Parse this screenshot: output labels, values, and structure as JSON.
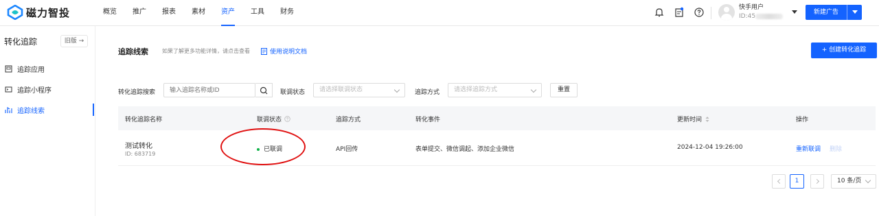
{
  "brand": {
    "name": "磁力智投",
    "accent": "#1463ff"
  },
  "nav": {
    "items": [
      "概览",
      "推广",
      "报表",
      "素材",
      "资产",
      "工具",
      "财务"
    ],
    "active_index": 4
  },
  "topbar": {
    "icons": [
      "bell-icon",
      "message-icon",
      "help-icon"
    ],
    "user": {
      "name": "快手用户",
      "id_prefix": "ID:45"
    },
    "new_ad_label": "新建广告"
  },
  "sidebar": {
    "title": "转化追踪",
    "old_version_label": "旧版 →",
    "items": [
      {
        "label": "追踪应用",
        "icon": "app-icon",
        "active": false
      },
      {
        "label": "追踪小程序",
        "icon": "mini-program-icon",
        "active": false
      },
      {
        "label": "追踪线索",
        "icon": "leads-icon",
        "active": true
      }
    ]
  },
  "header": {
    "title": "追踪线索",
    "tip": "如果了解更多功能详情，请点击查看",
    "doc_link": "使用说明文档",
    "create_button": "+ 创建转化追踪"
  },
  "filters": {
    "search_label": "转化追踪搜索",
    "search_placeholder": "输入追踪名称或ID",
    "status_label": "联调状态",
    "status_placeholder": "请选择联调状态",
    "method_label": "追踪方式",
    "method_placeholder": "请选择追踪方式",
    "reset_label": "重置"
  },
  "table": {
    "columns": [
      "转化追踪名称",
      "联调状态",
      "追踪方式",
      "转化事件",
      "更新时间",
      "操作"
    ],
    "rows": [
      {
        "name": "测试转化",
        "id": "ID: 683719",
        "status": "已联调",
        "method": "API回传",
        "events": "表单提交、微信调起、添加企业微信",
        "updated": "2024-12-04 19:26:00",
        "op_primary": "重新联调",
        "op_secondary": "删除"
      }
    ]
  },
  "pagination": {
    "current_page": "1",
    "page_size": "10 条/页"
  },
  "colors": {
    "status_green": "#12b34a",
    "annotation_red": "#e01010"
  }
}
